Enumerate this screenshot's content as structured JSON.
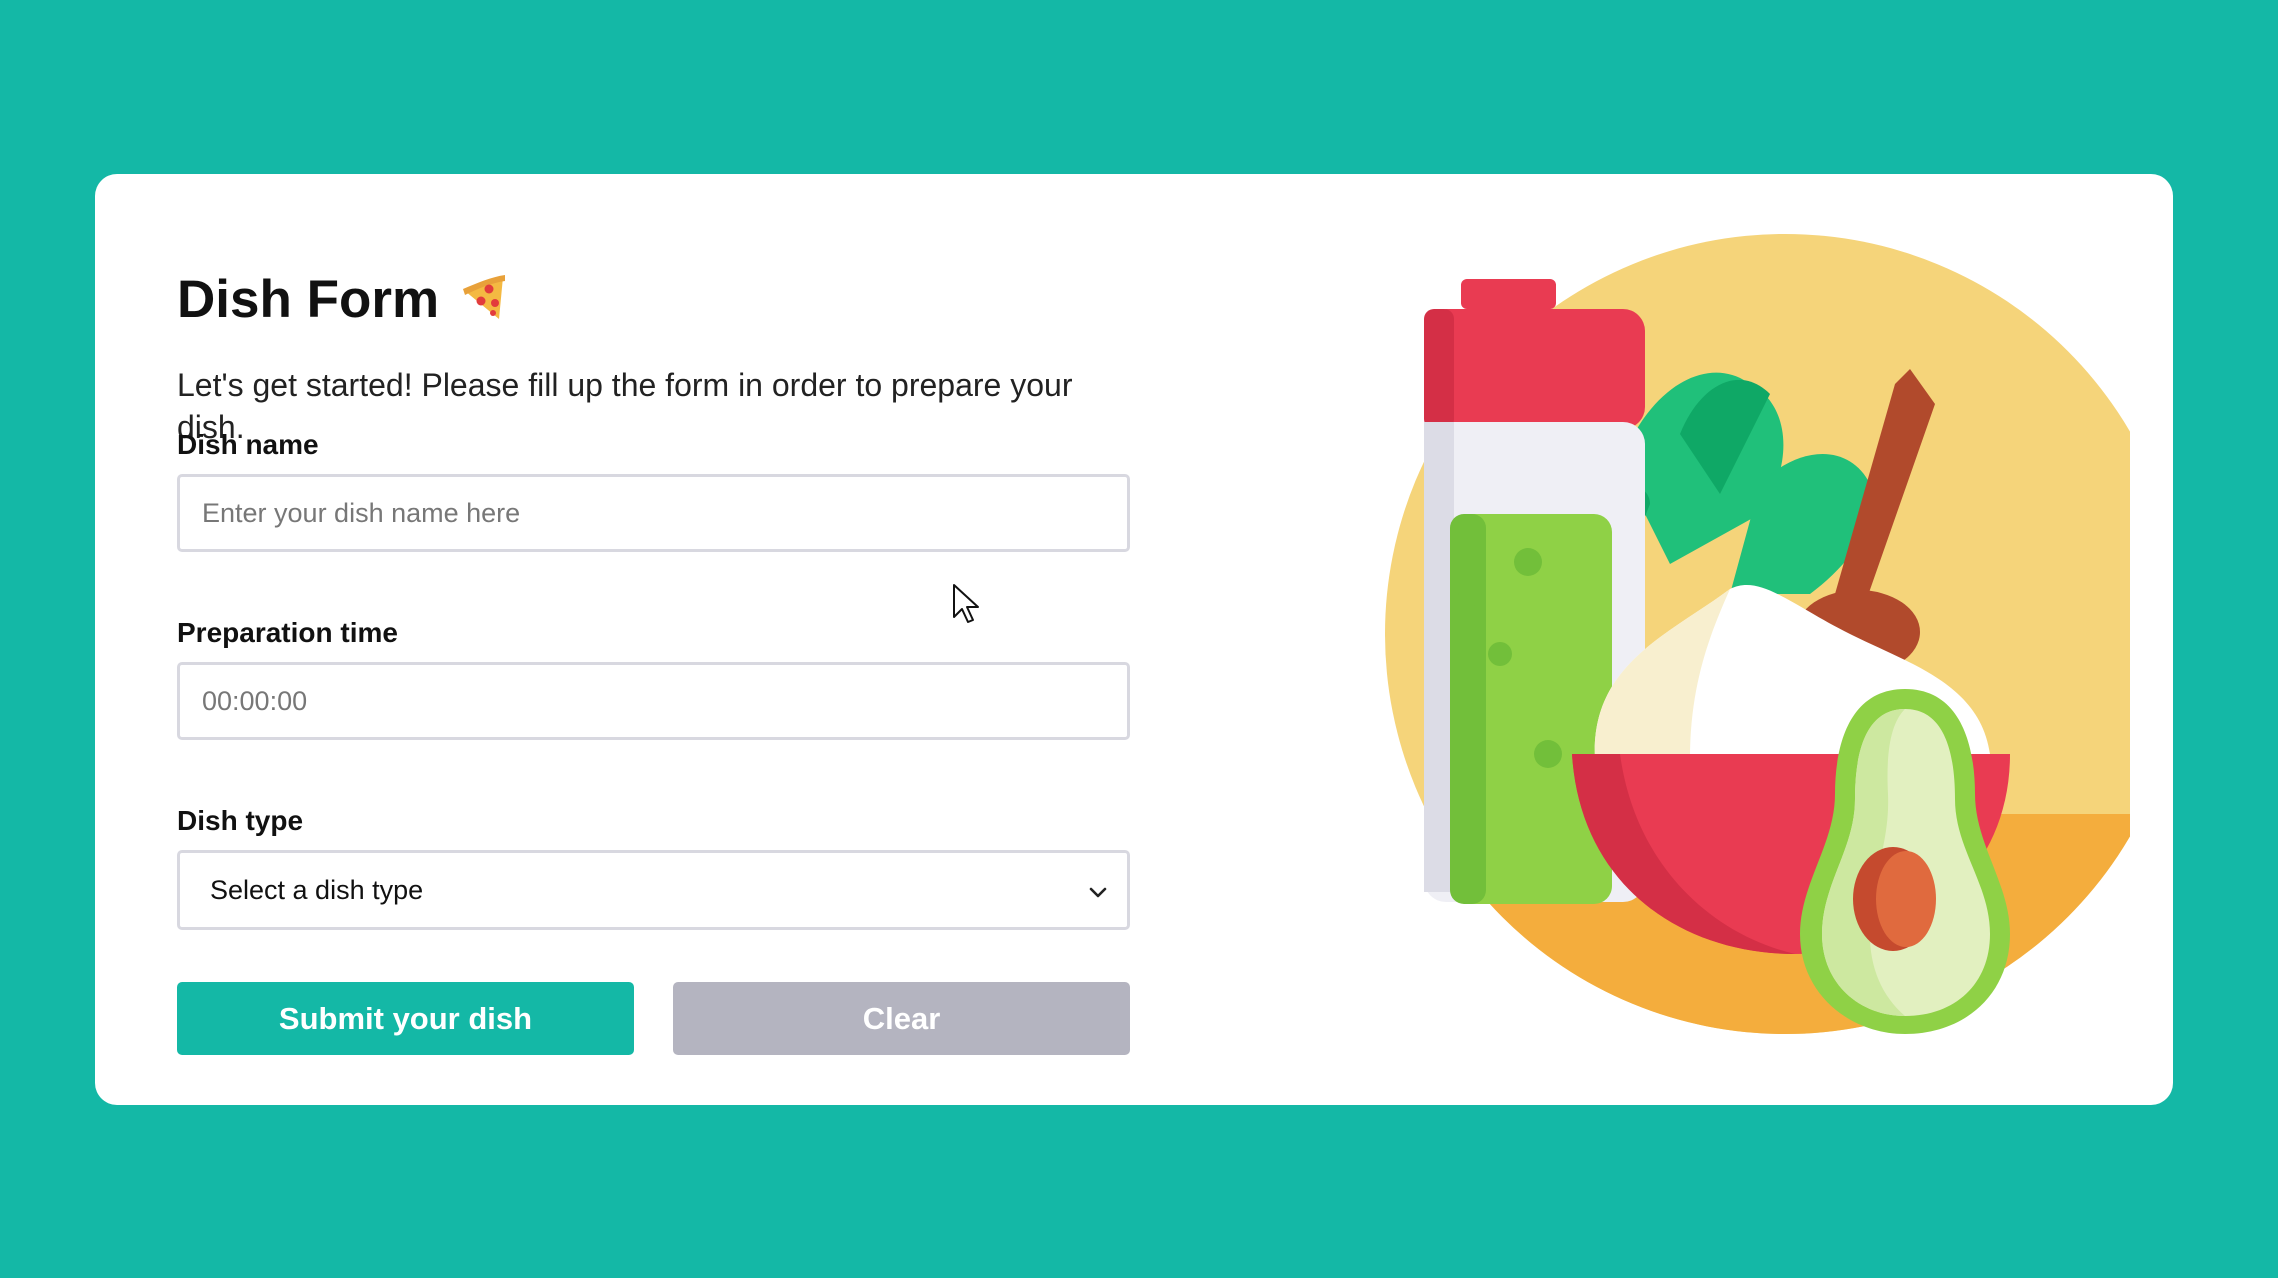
{
  "form": {
    "title": "Dish Form",
    "title_emoji_icon": "pizza-icon",
    "subtitle": "Let's get started! Please fill up the form in order to prepare your dish.",
    "dish_name": {
      "label": "Dish name",
      "value": "",
      "placeholder": "Enter your dish name here"
    },
    "prep_time": {
      "label": "Preparation time",
      "value": "",
      "placeholder": "00:00:00"
    },
    "dish_type": {
      "label": "Dish type",
      "selected": "Select a dish type",
      "icon": "chevron-down-icon"
    },
    "submit_label": "Submit your dish",
    "clear_label": "Clear"
  },
  "illustration": {
    "icon": "food-illustration",
    "subject": "salad bowl, juice bottle and avocado"
  },
  "colors": {
    "background": "#14b8a6",
    "card": "#ffffff",
    "submit_button": "#14b8a6",
    "clear_button": "#b4b4c0"
  }
}
